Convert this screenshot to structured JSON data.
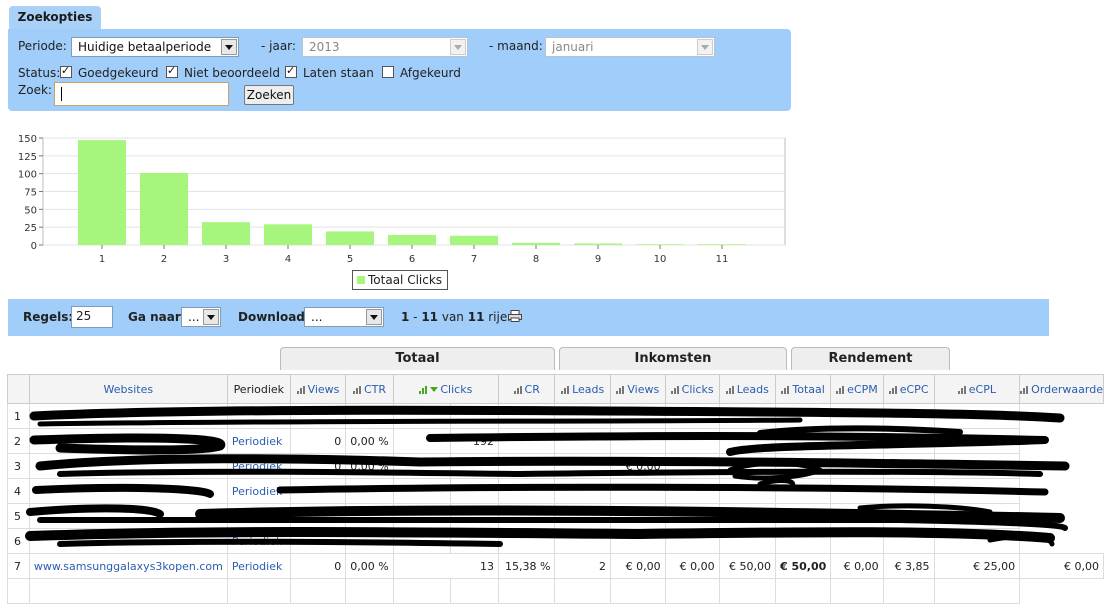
{
  "search_options": {
    "tab_label": "Zoekopties",
    "period_label": "Periode:",
    "period_value": "Huidige betaalperiode",
    "year_label": "- jaar:",
    "year_value": "2013",
    "month_label": "- maand:",
    "month_value": "januari",
    "status_label": "Status:",
    "statuses": [
      {
        "label": "Goedgekeurd",
        "checked": true
      },
      {
        "label": "Niet beoordeeld",
        "checked": true
      },
      {
        "label": "Laten staan",
        "checked": true
      },
      {
        "label": "Afgekeurd",
        "checked": false
      }
    ],
    "search_label": "Zoek:",
    "search_value": "",
    "search_button": "Zoeken"
  },
  "chart_data": {
    "type": "bar",
    "categories": [
      "1",
      "2",
      "3",
      "4",
      "5",
      "6",
      "7",
      "8",
      "9",
      "10",
      "11"
    ],
    "series": [
      {
        "name": "Totaal Clicks",
        "values": [
          147,
          101,
          32,
          29,
          19,
          14,
          13,
          3,
          2,
          1,
          1
        ]
      }
    ],
    "ylim": [
      0,
      150
    ],
    "yticks": [
      "0",
      "25",
      "50",
      "75",
      "100",
      "125",
      "150"
    ],
    "grid": true,
    "legend_position": "bottom",
    "color": "#a6f57d"
  },
  "toolbar": {
    "rows_label": "Regels:",
    "rows_value": "25",
    "goto_label": "Ga naar:",
    "goto_value": "...",
    "download_label": "Download:",
    "download_value": "...",
    "range_start": "1",
    "range_sep": " - ",
    "range_end": "11",
    "range_of": " van ",
    "range_total": "11",
    "range_suffix": " rijen",
    "print_icon": "printer-icon"
  },
  "groups": [
    "Totaal",
    "Inkomsten",
    "Rendement"
  ],
  "columns": [
    "Websites",
    "Periodiek",
    "Views",
    "CTR",
    "Clicks",
    "CR",
    "Leads",
    "Views",
    "Clicks",
    "Leads",
    "Totaal",
    "eCPM",
    "eCPC",
    "eCPL",
    "Orderwaarde"
  ],
  "row_numbers": [
    "1",
    "2",
    "3",
    "4",
    "5",
    "6"
  ],
  "visible_fragments": {
    "r2_a": "Periodiek",
    "r2_b": "0",
    "r2_c": "0,00 %",
    "r2_d": "192",
    "r3_a": "Periodiek",
    "r3_b": "0",
    "r3_c": "0,00 %",
    "r3_d": "€ 0,00",
    "r4_a": "Periodiek",
    "r6_a": "Periodiek"
  },
  "row7": {
    "index": "7",
    "website": "www.samsunggalaxys3kopen.com",
    "periodiek": "Periodiek",
    "views": "0",
    "ctr": "0,00 %",
    "clicks": "13",
    "cr": "15,38 %",
    "leads": "2",
    "ink_views": "€ 0,00",
    "ink_clicks": "€ 0,00",
    "ink_leads": "€ 50,00",
    "ink_totaal": "€ 50,00",
    "ecpm": "€ 0,00",
    "ecpc": "€ 3,85",
    "ecpl": "€ 25,00",
    "orderwaarde": "€ 0,00"
  }
}
